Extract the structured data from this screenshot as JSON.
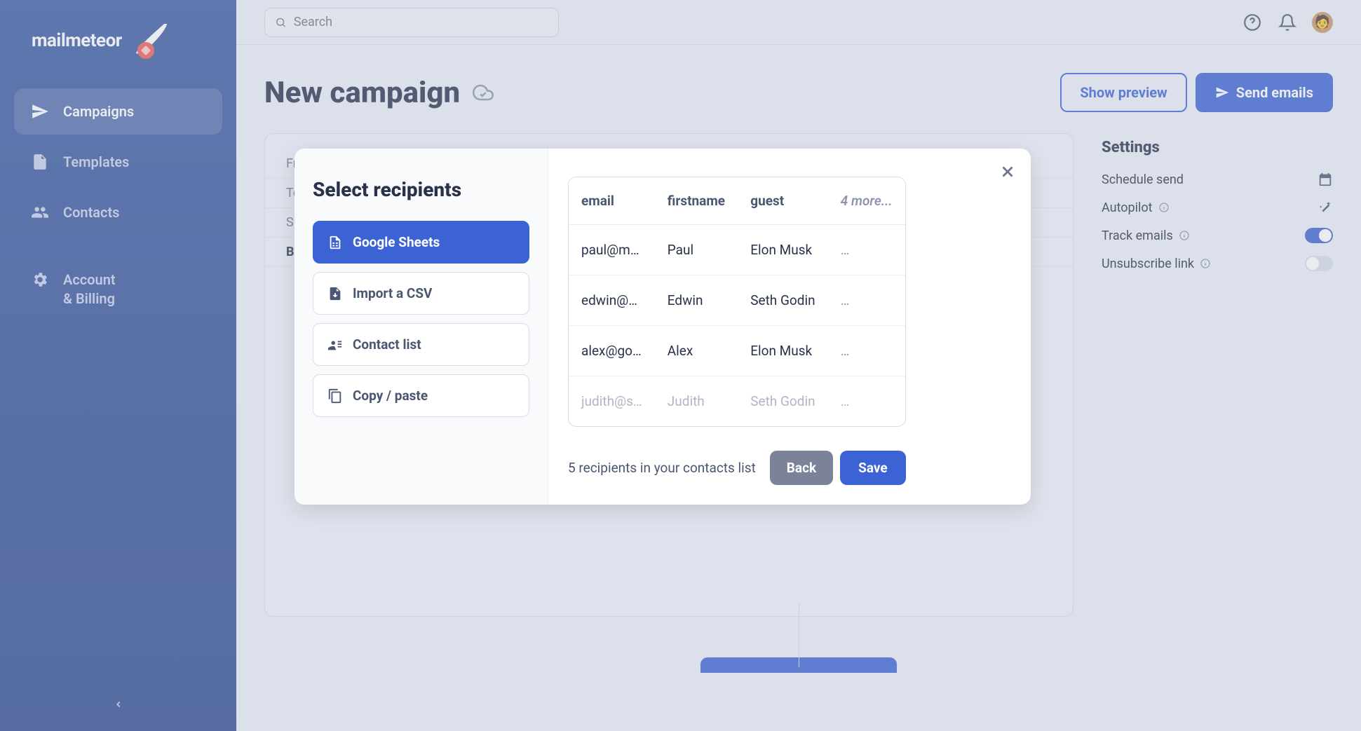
{
  "brand": "mailmeteor",
  "sidebar": {
    "items": [
      {
        "label": "Campaigns",
        "icon": "send-icon",
        "active": true
      },
      {
        "label": "Templates",
        "icon": "file-icon",
        "active": false
      },
      {
        "label": "Contacts",
        "icon": "contacts-icon",
        "active": false
      }
    ],
    "account_label_line1": "Account",
    "account_label_line2": "& Billing"
  },
  "topbar": {
    "search_placeholder": "Search"
  },
  "page": {
    "title": "New campaign",
    "show_preview": "Show preview",
    "send_emails": "Send emails",
    "compose_rows": [
      "Fr",
      "To",
      "Su",
      "B"
    ]
  },
  "settings": {
    "heading": "Settings",
    "schedule": "Schedule send",
    "autopilot": "Autopilot",
    "track": "Track emails",
    "unsubscribe": "Unsubscribe link",
    "track_on": true,
    "unsubscribe_on": false
  },
  "modal": {
    "title": "Select recipients",
    "sources": [
      {
        "label": "Google Sheets",
        "icon": "sheets-icon",
        "active": true
      },
      {
        "label": "Import a CSV",
        "icon": "upload-file-icon",
        "active": false
      },
      {
        "label": "Contact list",
        "icon": "contact-list-icon",
        "active": false
      },
      {
        "label": "Copy / paste",
        "icon": "copy-icon",
        "active": false
      }
    ],
    "columns": [
      "email",
      "firstname",
      "guest"
    ],
    "more_columns": "4 more...",
    "rows": [
      {
        "email": "paul@m…",
        "firstname": "Paul",
        "guest": "Elon Musk",
        "more": "…"
      },
      {
        "email": "edwin@…",
        "firstname": "Edwin",
        "guest": "Seth Godin",
        "more": "…"
      },
      {
        "email": "alex@go…",
        "firstname": "Alex",
        "guest": "Elon Musk",
        "more": "…"
      },
      {
        "email": "judith@s…",
        "firstname": "Judith",
        "guest": "Seth Godin",
        "more": "…"
      }
    ],
    "count_text": "5 recipients in your contacts list",
    "back": "Back",
    "save": "Save"
  }
}
